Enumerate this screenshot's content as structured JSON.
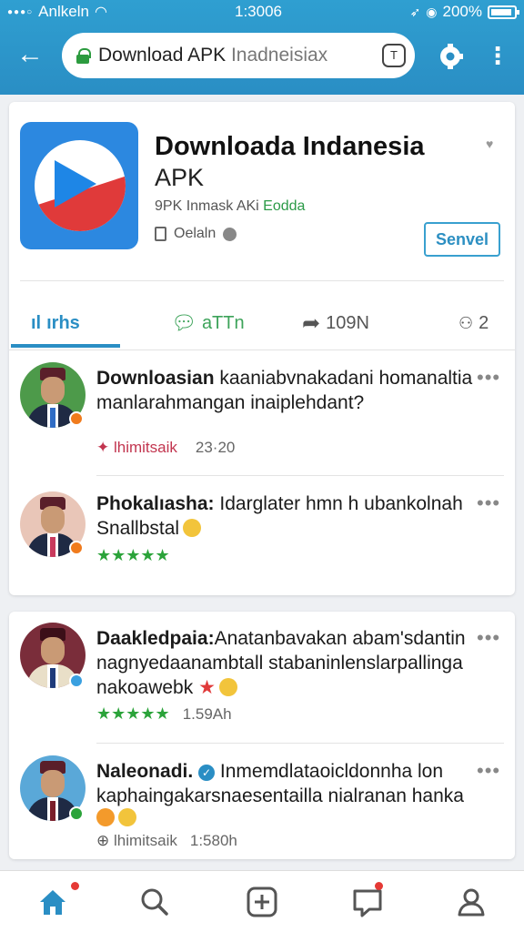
{
  "status_bar": {
    "carrier": "Anlkeln",
    "time": "1:3006",
    "battery": "200%"
  },
  "browser": {
    "url_main": "Download APK ",
    "url_muted": "Inadneisiax",
    "tabs_count": "T"
  },
  "app": {
    "title": "Downloada Indanesia",
    "title_line2": "APK",
    "meta_prefix": "9PK Inmask AKi ",
    "meta_green": "Eodda",
    "developer": "Oelaln",
    "follow_label": "Senvel"
  },
  "tabs": [
    {
      "label": "ırhs"
    },
    {
      "label": "aTTn"
    },
    {
      "label": "109N"
    },
    {
      "label": "2"
    }
  ],
  "posts": [
    {
      "text_bold": "Downloasian",
      "text": " kaaniabvnakadani homanaltia manlarahmangan inaiplehdant?",
      "tag": "lhimitsaik",
      "time": "23·20"
    },
    {
      "text_bold": "Phokalıasha:",
      "text": " Idarglater hmn h ubankolnah Snallbstal",
      "stars": "★★★★★"
    },
    {
      "text_bold": "Daakledpaia:",
      "text": "Anatanbavakan abam'sdantin nagnyedaanambtall stabaninlenslarpallinga nakoawebk",
      "stars": "★★★★★",
      "time": "1.59Ah"
    },
    {
      "text_bold": "Naleonadi.",
      "text": " Inmemdlataoicldonnha lon kaphaingakarsnaesentailla nialranan hanka",
      "tag": "lhimitsaik",
      "time": "1:580h"
    }
  ],
  "colors": {
    "header": "#2a8ec4",
    "accent": "#2a8ec4",
    "green": "#2b9a47"
  }
}
